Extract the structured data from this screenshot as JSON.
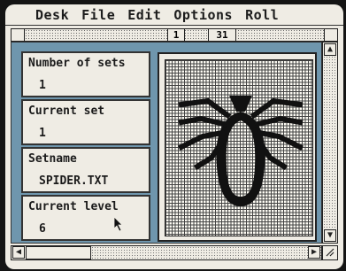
{
  "menu": [
    "Desk",
    "File",
    "Edit",
    "Options",
    "Roll"
  ],
  "header": {
    "seg1": "1",
    "seg2": "31"
  },
  "panels": [
    {
      "label": "Number of sets",
      "value": "1"
    },
    {
      "label": "Current set",
      "value": "1"
    },
    {
      "label": "Setname",
      "value": "SPIDER.TXT"
    },
    {
      "label": "Current level",
      "value": "6"
    }
  ],
  "icons": {
    "up": "arrow-up-icon",
    "down": "arrow-down-icon",
    "left": "arrow-left-icon",
    "right": "arrow-right-icon",
    "cursor": "mouse-pointer-icon"
  },
  "colors": {
    "workspace": "#6f96ad",
    "spider": "#111111"
  }
}
